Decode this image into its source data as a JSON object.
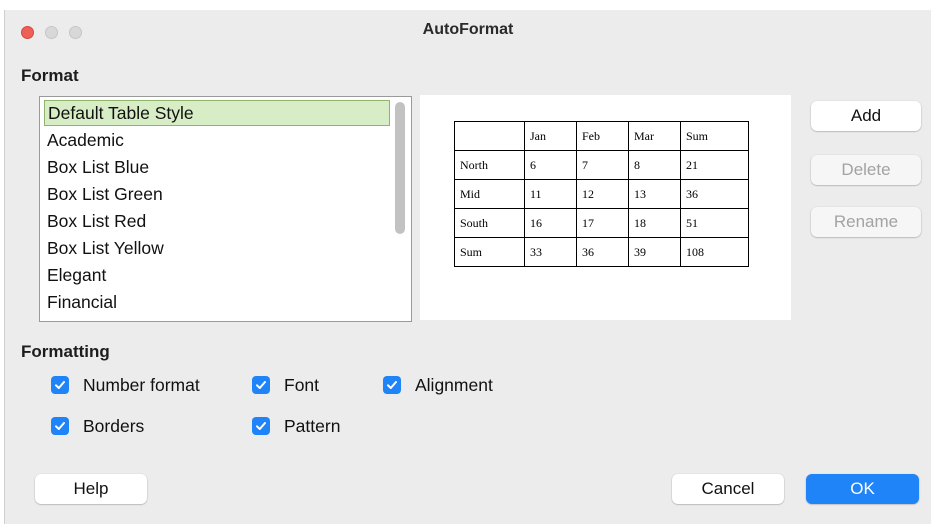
{
  "window": {
    "title": "AutoFormat"
  },
  "format_section": {
    "label": "Format"
  },
  "styles": {
    "items": [
      "Default Table Style",
      "Academic",
      "Box List Blue",
      "Box List Green",
      "Box List Red",
      "Box List Yellow",
      "Elegant",
      "Financial"
    ],
    "selected": "Default Table Style"
  },
  "preview": {
    "rows": [
      [
        "",
        "Jan",
        "Feb",
        "Mar",
        "Sum"
      ],
      [
        "North",
        "6",
        "7",
        "8",
        "21"
      ],
      [
        "Mid",
        "11",
        "12",
        "13",
        "36"
      ],
      [
        "South",
        "16",
        "17",
        "18",
        "51"
      ],
      [
        "Sum",
        "33",
        "36",
        "39",
        "108"
      ]
    ]
  },
  "side_buttons": {
    "add": "Add",
    "delete": "Delete",
    "rename": "Rename"
  },
  "formatting_section": {
    "label": "Formatting",
    "options": {
      "number_format": {
        "label": "Number format",
        "checked": true
      },
      "font": {
        "label": "Font",
        "checked": true
      },
      "alignment": {
        "label": "Alignment",
        "checked": true
      },
      "borders": {
        "label": "Borders",
        "checked": true
      },
      "pattern": {
        "label": "Pattern",
        "checked": true
      }
    }
  },
  "footer": {
    "help": "Help",
    "cancel": "Cancel",
    "ok": "OK"
  },
  "colors": {
    "accent": "#1f84f7",
    "selection": "#d7edc5",
    "close": "#ee5f57"
  }
}
